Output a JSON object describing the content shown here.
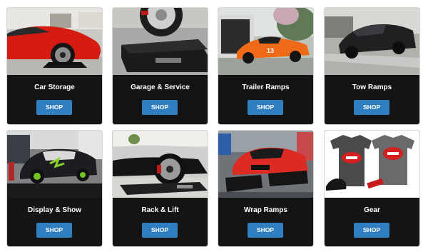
{
  "categories": [
    {
      "title": "Car Storage",
      "button": "SHOP",
      "image": "red-sports-car-on-ramps-photo"
    },
    {
      "title": "Garage & Service",
      "button": "SHOP",
      "image": "tire-on-black-ramp-photo"
    },
    {
      "title": "Trailer Ramps",
      "button": "SHOP",
      "image": "orange-race-car-trailer-photo"
    },
    {
      "title": "Tow Ramps",
      "button": "SHOP",
      "image": "black-sedan-on-tow-truck-photo"
    },
    {
      "title": "Display & Show",
      "button": "SHOP",
      "image": "green-monster-drift-car-photo"
    },
    {
      "title": "Rack & Lift",
      "button": "SHOP",
      "image": "car-wheel-on-lift-ramp-photo"
    },
    {
      "title": "Wrap Ramps",
      "button": "SHOP",
      "image": "red-audi-on-display-ramps-photo"
    },
    {
      "title": "Gear",
      "button": "SHOP",
      "image": "race-ramps-shirts-and-cap-photo"
    }
  ],
  "brand_colors": {
    "button": "#2f7ec2",
    "card": "#141414"
  }
}
